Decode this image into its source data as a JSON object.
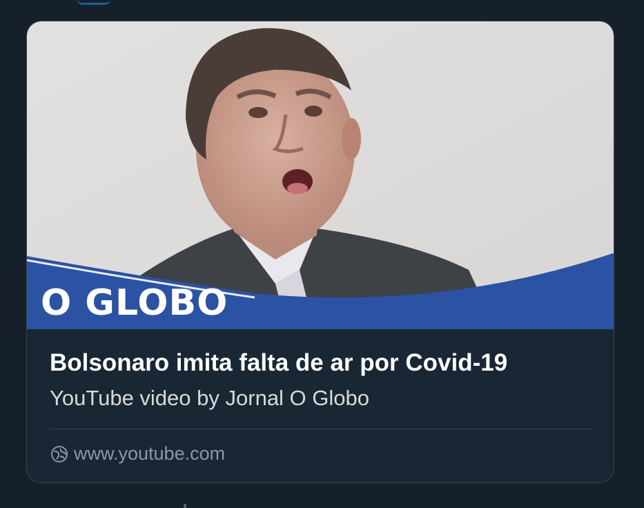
{
  "card": {
    "logo_text": "O GLOBO",
    "title": "Bolsonaro imita falta de ar por Covid-19",
    "subtitle": "YouTube video by Jornal O Globo",
    "domain": "www.youtube.com",
    "domain_icon": "globe-icon"
  },
  "colors": {
    "background": "#15202b",
    "card_background": "#192734",
    "border": "#38444d",
    "banner_blue": "#2b52a3",
    "muted_text": "#8b98a5"
  }
}
